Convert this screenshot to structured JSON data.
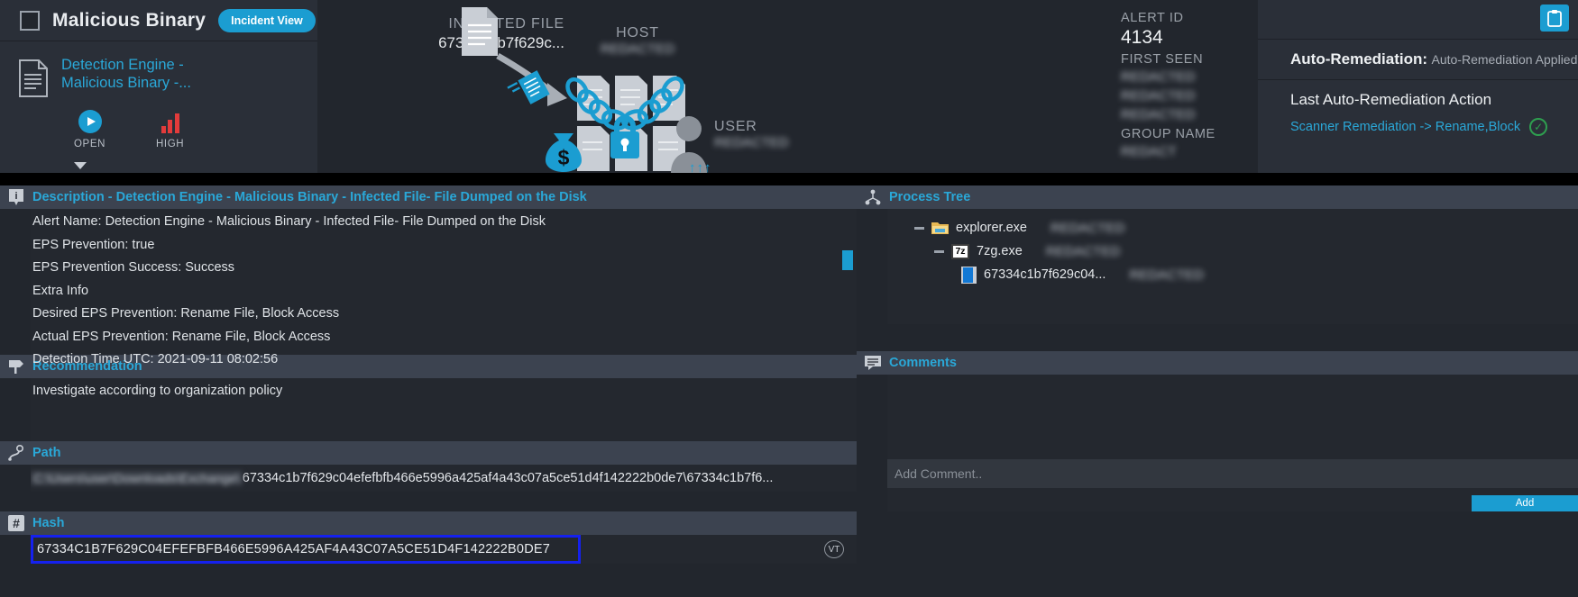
{
  "header": {
    "alert_title": "Malicious Binary",
    "incident_view_button": "Incident View",
    "engine_name": "Detection Engine - Malicious Binary -...",
    "status_label": "OPEN",
    "severity_label": "HIGH"
  },
  "diagram": {
    "infected_file_caption": "INFECTED FILE",
    "infected_file_value": "67334c1b7f629c...",
    "host_caption": "HOST",
    "host_value": "REDACTED",
    "user_caption": "USER",
    "user_value": "REDACTED",
    "arrows": "↑↑↑"
  },
  "alert_info": {
    "alert_id_caption": "ALERT ID",
    "alert_id_value": "4134",
    "first_seen_caption": "FIRST SEEN",
    "first_seen_value": "REDACTED",
    "last_seen_value": "REDACTED",
    "extra_value": "REDACTED",
    "group_name_caption": "GROUP NAME",
    "group_name_value": "REDACT"
  },
  "remediation": {
    "auto_remediation_label": "Auto-Remediation:",
    "auto_remediation_status": "Auto-Remediation Applied",
    "last_action_title": "Last Auto-Remediation Action",
    "last_action_link": "Scanner Remediation -> Rename,Block"
  },
  "description": {
    "section_title": "Description - Detection Engine - Malicious Binary - Infected File- File Dumped on the Disk",
    "lines": [
      "Alert Name: Detection Engine - Malicious Binary - Infected File- File Dumped on the Disk",
      "EPS Prevention: true",
      "EPS Prevention Success: Success",
      "Extra Info",
      "Desired EPS Prevention: Rename File, Block Access",
      "Actual EPS Prevention: Rename File, Block Access",
      "Detection Time UTC: 2021-09-11 08:02:56"
    ]
  },
  "recommendation": {
    "section_title": "Recommendation",
    "text": "Investigate according to organization policy"
  },
  "path": {
    "section_title": "Path",
    "redacted_prefix": "C:\\Users\\user\\Downloads\\Exchange\\",
    "value": "67334c1b7f629c04efefbfb466e5996a425af4a43c07a5ce51d4f142222b0de7\\67334c1b7f6..."
  },
  "hash": {
    "section_title": "Hash",
    "value": "67334C1B7F629C04EFEFBFB466E5996A425AF4A43C07A5CE51D4F142222B0DE7",
    "vt_badge": "VT",
    "selection_color": "#1521ee"
  },
  "process_tree": {
    "section_title": "Process Tree",
    "nodes": [
      {
        "name": "explorer.exe",
        "meta": "REDACTED",
        "icon": "folder-icon"
      },
      {
        "name": "7zg.exe",
        "meta": "REDACTED",
        "icon": "zip-icon"
      },
      {
        "name": "67334c1b7f629c04...",
        "meta": "REDACTED",
        "icon": "binary-file-icon"
      }
    ]
  },
  "comments": {
    "section_title": "Comments",
    "placeholder": "Add Comment..",
    "value": "",
    "add_button": "Add"
  },
  "colors": {
    "accent": "#1b9dd1",
    "link": "#2aa8d8",
    "severity_high": "#e23b3b",
    "success": "#2e9e4f",
    "panel_bg": "#24282f",
    "header_bg": "#3c4350"
  }
}
